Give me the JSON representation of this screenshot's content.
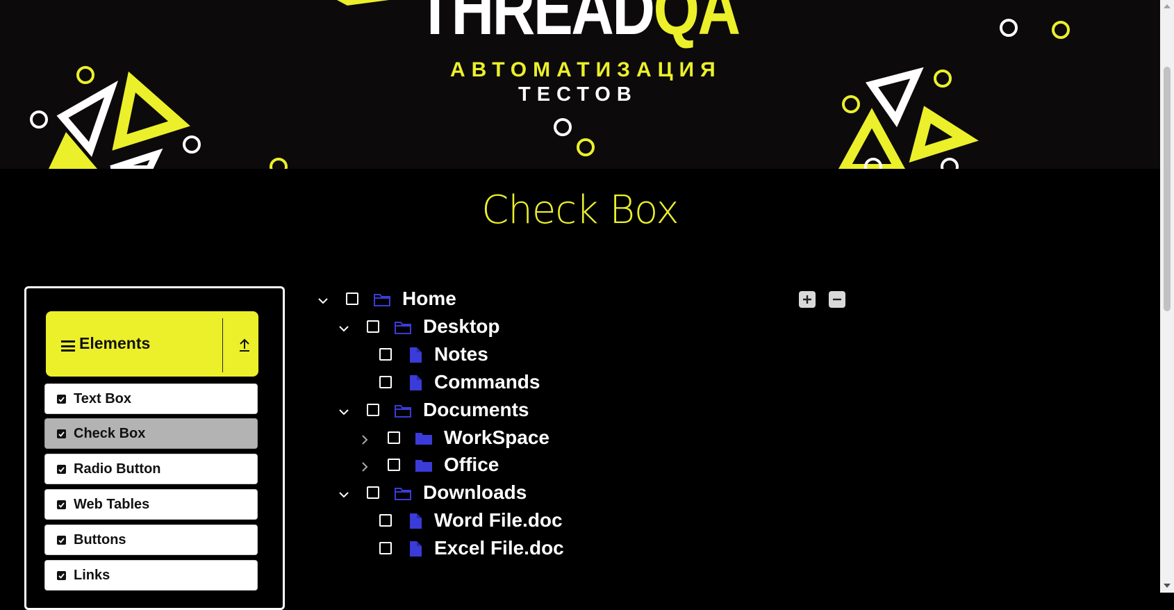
{
  "banner": {
    "logo_white": "THREAD",
    "logo_yellow": "QA",
    "subtitle_line1": "АВТОМАТИЗАЦИЯ",
    "subtitle_line2": "ТЕСТОВ"
  },
  "page_title": "Check Box",
  "sidebar": {
    "group_title": "Elements",
    "items": [
      {
        "label": "Text Box"
      },
      {
        "label": "Check Box"
      },
      {
        "label": "Radio Button"
      },
      {
        "label": "Web Tables"
      },
      {
        "label": "Buttons"
      },
      {
        "label": "Links"
      }
    ],
    "active_item": "Check Box"
  },
  "tree": {
    "expand_all_icon": "plus-square-icon",
    "collapse_all_icon": "minus-square-icon",
    "nodes": [
      {
        "label": "Home",
        "type": "folder",
        "expanded": true,
        "checked": false
      },
      {
        "label": "Desktop",
        "type": "folder",
        "expanded": true,
        "checked": false
      },
      {
        "label": "Notes",
        "type": "file",
        "checked": false
      },
      {
        "label": "Commands",
        "type": "file",
        "checked": false
      },
      {
        "label": "Documents",
        "type": "folder",
        "expanded": true,
        "checked": false
      },
      {
        "label": "WorkSpace",
        "type": "folder",
        "expanded": false,
        "checked": false
      },
      {
        "label": "Office",
        "type": "folder",
        "expanded": false,
        "checked": false
      },
      {
        "label": "Downloads",
        "type": "folder",
        "expanded": true,
        "checked": false
      },
      {
        "label": "Word File.doc",
        "type": "file",
        "checked": false
      },
      {
        "label": "Excel File.doc",
        "type": "file",
        "checked": false
      }
    ]
  },
  "colors": {
    "accent": "#ebf02a",
    "background": "#000000",
    "icon_blue": "#3b3bd9",
    "active_item": "#b3b3b3"
  }
}
